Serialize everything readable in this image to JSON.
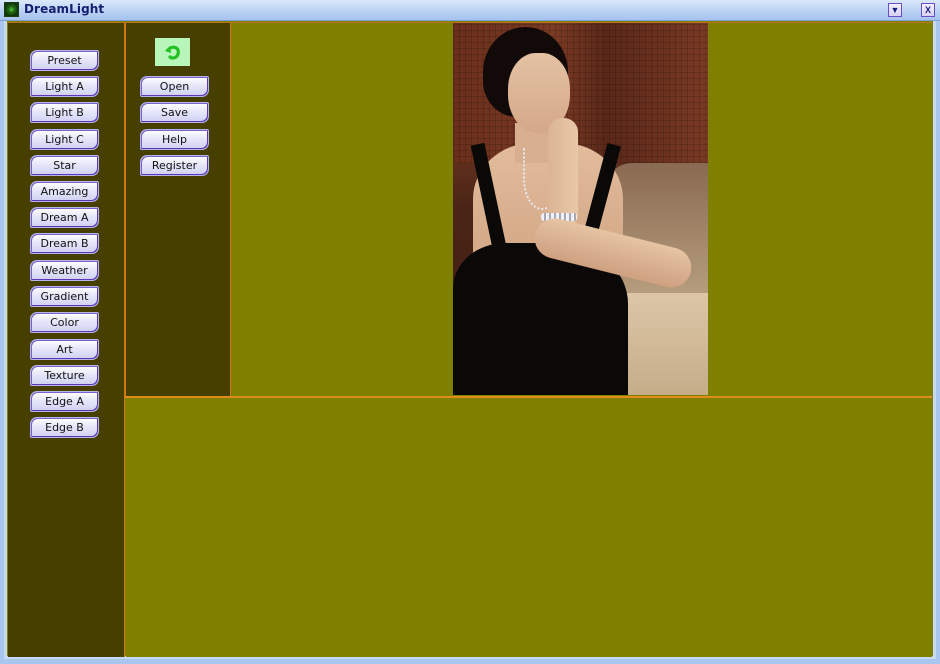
{
  "window": {
    "title": "DreamLight",
    "minimize_glyph": "▼",
    "close_glyph": "X"
  },
  "colors": {
    "panel_dark": "#463f00",
    "workspace": "#7f7f00",
    "separator": "#e08c1a",
    "titlebar": "#b7cff3",
    "undo_bg": "#b8f5b8",
    "undo_arrow": "#22c022"
  },
  "effects_panel": {
    "buttons": [
      {
        "label": "Preset"
      },
      {
        "label": "Light A"
      },
      {
        "label": "Light B"
      },
      {
        "label": "Light C"
      },
      {
        "label": "Star"
      },
      {
        "label": "Amazing"
      },
      {
        "label": "Dream A"
      },
      {
        "label": "Dream B"
      },
      {
        "label": "Weather"
      },
      {
        "label": "Gradient"
      },
      {
        "label": "Color"
      },
      {
        "label": "Art"
      },
      {
        "label": "Texture"
      },
      {
        "label": "Edge A"
      },
      {
        "label": "Edge B"
      }
    ]
  },
  "file_panel": {
    "undo_icon": "undo-arrow-icon",
    "buttons": [
      {
        "label": "Open"
      },
      {
        "label": "Save"
      },
      {
        "label": "Help"
      },
      {
        "label": "Register"
      }
    ]
  },
  "preview": {
    "image_description": "Portrait photo of a woman in a black dress with necklace and bracelet, seated on a beige sofa"
  }
}
